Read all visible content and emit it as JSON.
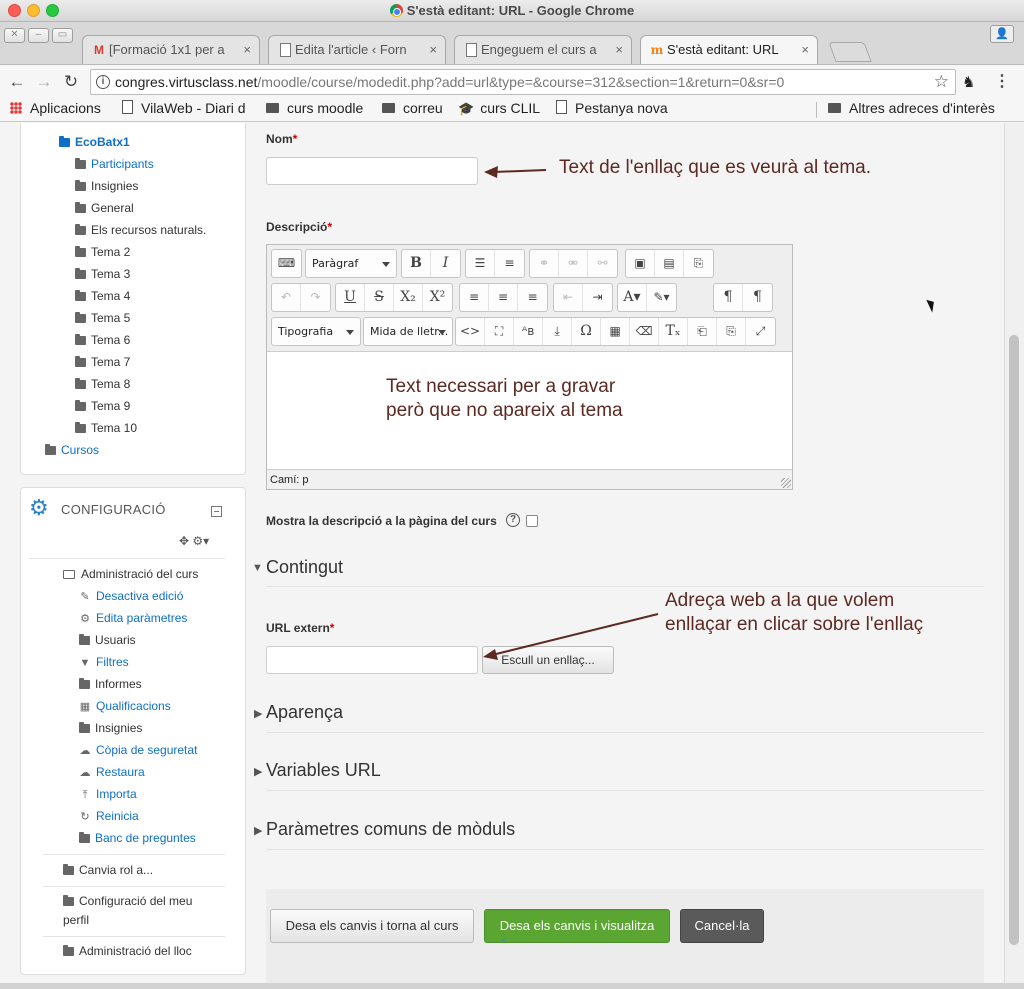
{
  "window": {
    "title": "S'està editant: URL - Google Chrome"
  },
  "tabs": [
    {
      "label": "[Formació 1x1 per a",
      "icon": "gmail-icon"
    },
    {
      "label": "Edita l'article ‹ Forn",
      "icon": "document-icon"
    },
    {
      "label": "Engeguem el curs a",
      "icon": "document-icon"
    },
    {
      "label": "S'està editant: URL",
      "icon": "moodle-icon",
      "active": true
    }
  ],
  "address": {
    "domain": "congres.virtusclass.net",
    "path": "/moodle/course/modedit.php?add=url&type=&course=312&section=1&return=0&sr=0"
  },
  "bookmarks": [
    {
      "label": "Aplicacions",
      "icon": "apps-icon"
    },
    {
      "label": "VilaWeb - Diari d",
      "icon": "page-icon"
    },
    {
      "label": "curs moodle",
      "icon": "folder-icon"
    },
    {
      "label": "correu",
      "icon": "folder-icon"
    },
    {
      "label": "curs CLIL",
      "icon": "graduation-cap-icon"
    },
    {
      "label": "Pestanya nova",
      "icon": "page-icon"
    },
    {
      "label": "Altres adreces d'interès",
      "icon": "folder-icon"
    }
  ],
  "navigation": {
    "course": "EcoBatx1",
    "items": [
      {
        "label": "Participants",
        "link": true
      },
      {
        "label": "Insignies",
        "link": false
      },
      {
        "label": "General",
        "link": false
      },
      {
        "label": "Els recursos naturals.",
        "link": false
      },
      {
        "label": "Tema 2",
        "link": false
      },
      {
        "label": "Tema 3",
        "link": false
      },
      {
        "label": "Tema 4",
        "link": false
      },
      {
        "label": "Tema 5",
        "link": false
      },
      {
        "label": "Tema 6",
        "link": false
      },
      {
        "label": "Tema 7",
        "link": false
      },
      {
        "label": "Tema 8",
        "link": false
      },
      {
        "label": "Tema 9",
        "link": false
      },
      {
        "label": "Tema 10",
        "link": false
      }
    ],
    "courses": "Cursos"
  },
  "config": {
    "title": "CONFIGURACIÓ",
    "admin_heading": "Administració del curs",
    "admin_items": [
      {
        "label": "Desactiva edició",
        "icon": "pencil-icon"
      },
      {
        "label": "Edita paràmetres",
        "icon": "gears-icon"
      },
      {
        "label": "Usuaris",
        "icon": "folder-icon",
        "plain": true
      },
      {
        "label": "Filtres",
        "icon": "filter-icon"
      },
      {
        "label": "Informes",
        "icon": "folder-icon",
        "plain": true
      },
      {
        "label": "Qualificacions",
        "icon": "table-icon"
      },
      {
        "label": "Insignies",
        "icon": "folder-icon",
        "plain": true
      },
      {
        "label": "Còpia de seguretat",
        "icon": "cloud-upload-icon"
      },
      {
        "label": "Restaura",
        "icon": "cloud-download-icon"
      },
      {
        "label": "Importa",
        "icon": "upload-icon"
      },
      {
        "label": "Reinicia",
        "icon": "refresh-icon"
      },
      {
        "label": "Banc de preguntes",
        "icon": "folder-icon"
      }
    ],
    "switch_role": "Canvia rol a...",
    "profile_line1": "Configuració del meu",
    "profile_line2": "perfil",
    "site_admin": "Administració del lloc"
  },
  "form": {
    "name_label": "Nom",
    "description_label": "Descripció",
    "required_mark": "*",
    "editor": {
      "paragraph_select": "Paràgraf",
      "font_select": "Tipografia",
      "size_select": "Mida de lletr...",
      "status_path": "Camí: p",
      "content_line1": "Text necessari per a gravar",
      "content_line2": "però que no apareix al tema"
    },
    "show_description_label": "Mostra la descripció a la pàgina del curs",
    "content_section": "Contingut",
    "url_label": "URL extern",
    "choose_link_button": "Escull un enllaç...",
    "sections": [
      "Aparença",
      "Variables URL",
      "Paràmetres comuns de mòduls"
    ],
    "buttons": {
      "save_return": "Desa els canvis i torna al curs",
      "save_display": "Desa els canvis i visualitza",
      "cancel": "Cancel·la"
    }
  },
  "annotations": {
    "name_note": "Text de l'enllaç que es veurà al tema.",
    "url_note_line1": "Adreça web a la que volem",
    "url_note_line2": "enllaçar en clicar sobre l'enllaç"
  },
  "colors": {
    "link": "#0f6fc5",
    "primary_button": "#5ba632",
    "cancel_button": "#5a5a5a",
    "annotation": "#5c2a22",
    "required": "#cc0000"
  }
}
